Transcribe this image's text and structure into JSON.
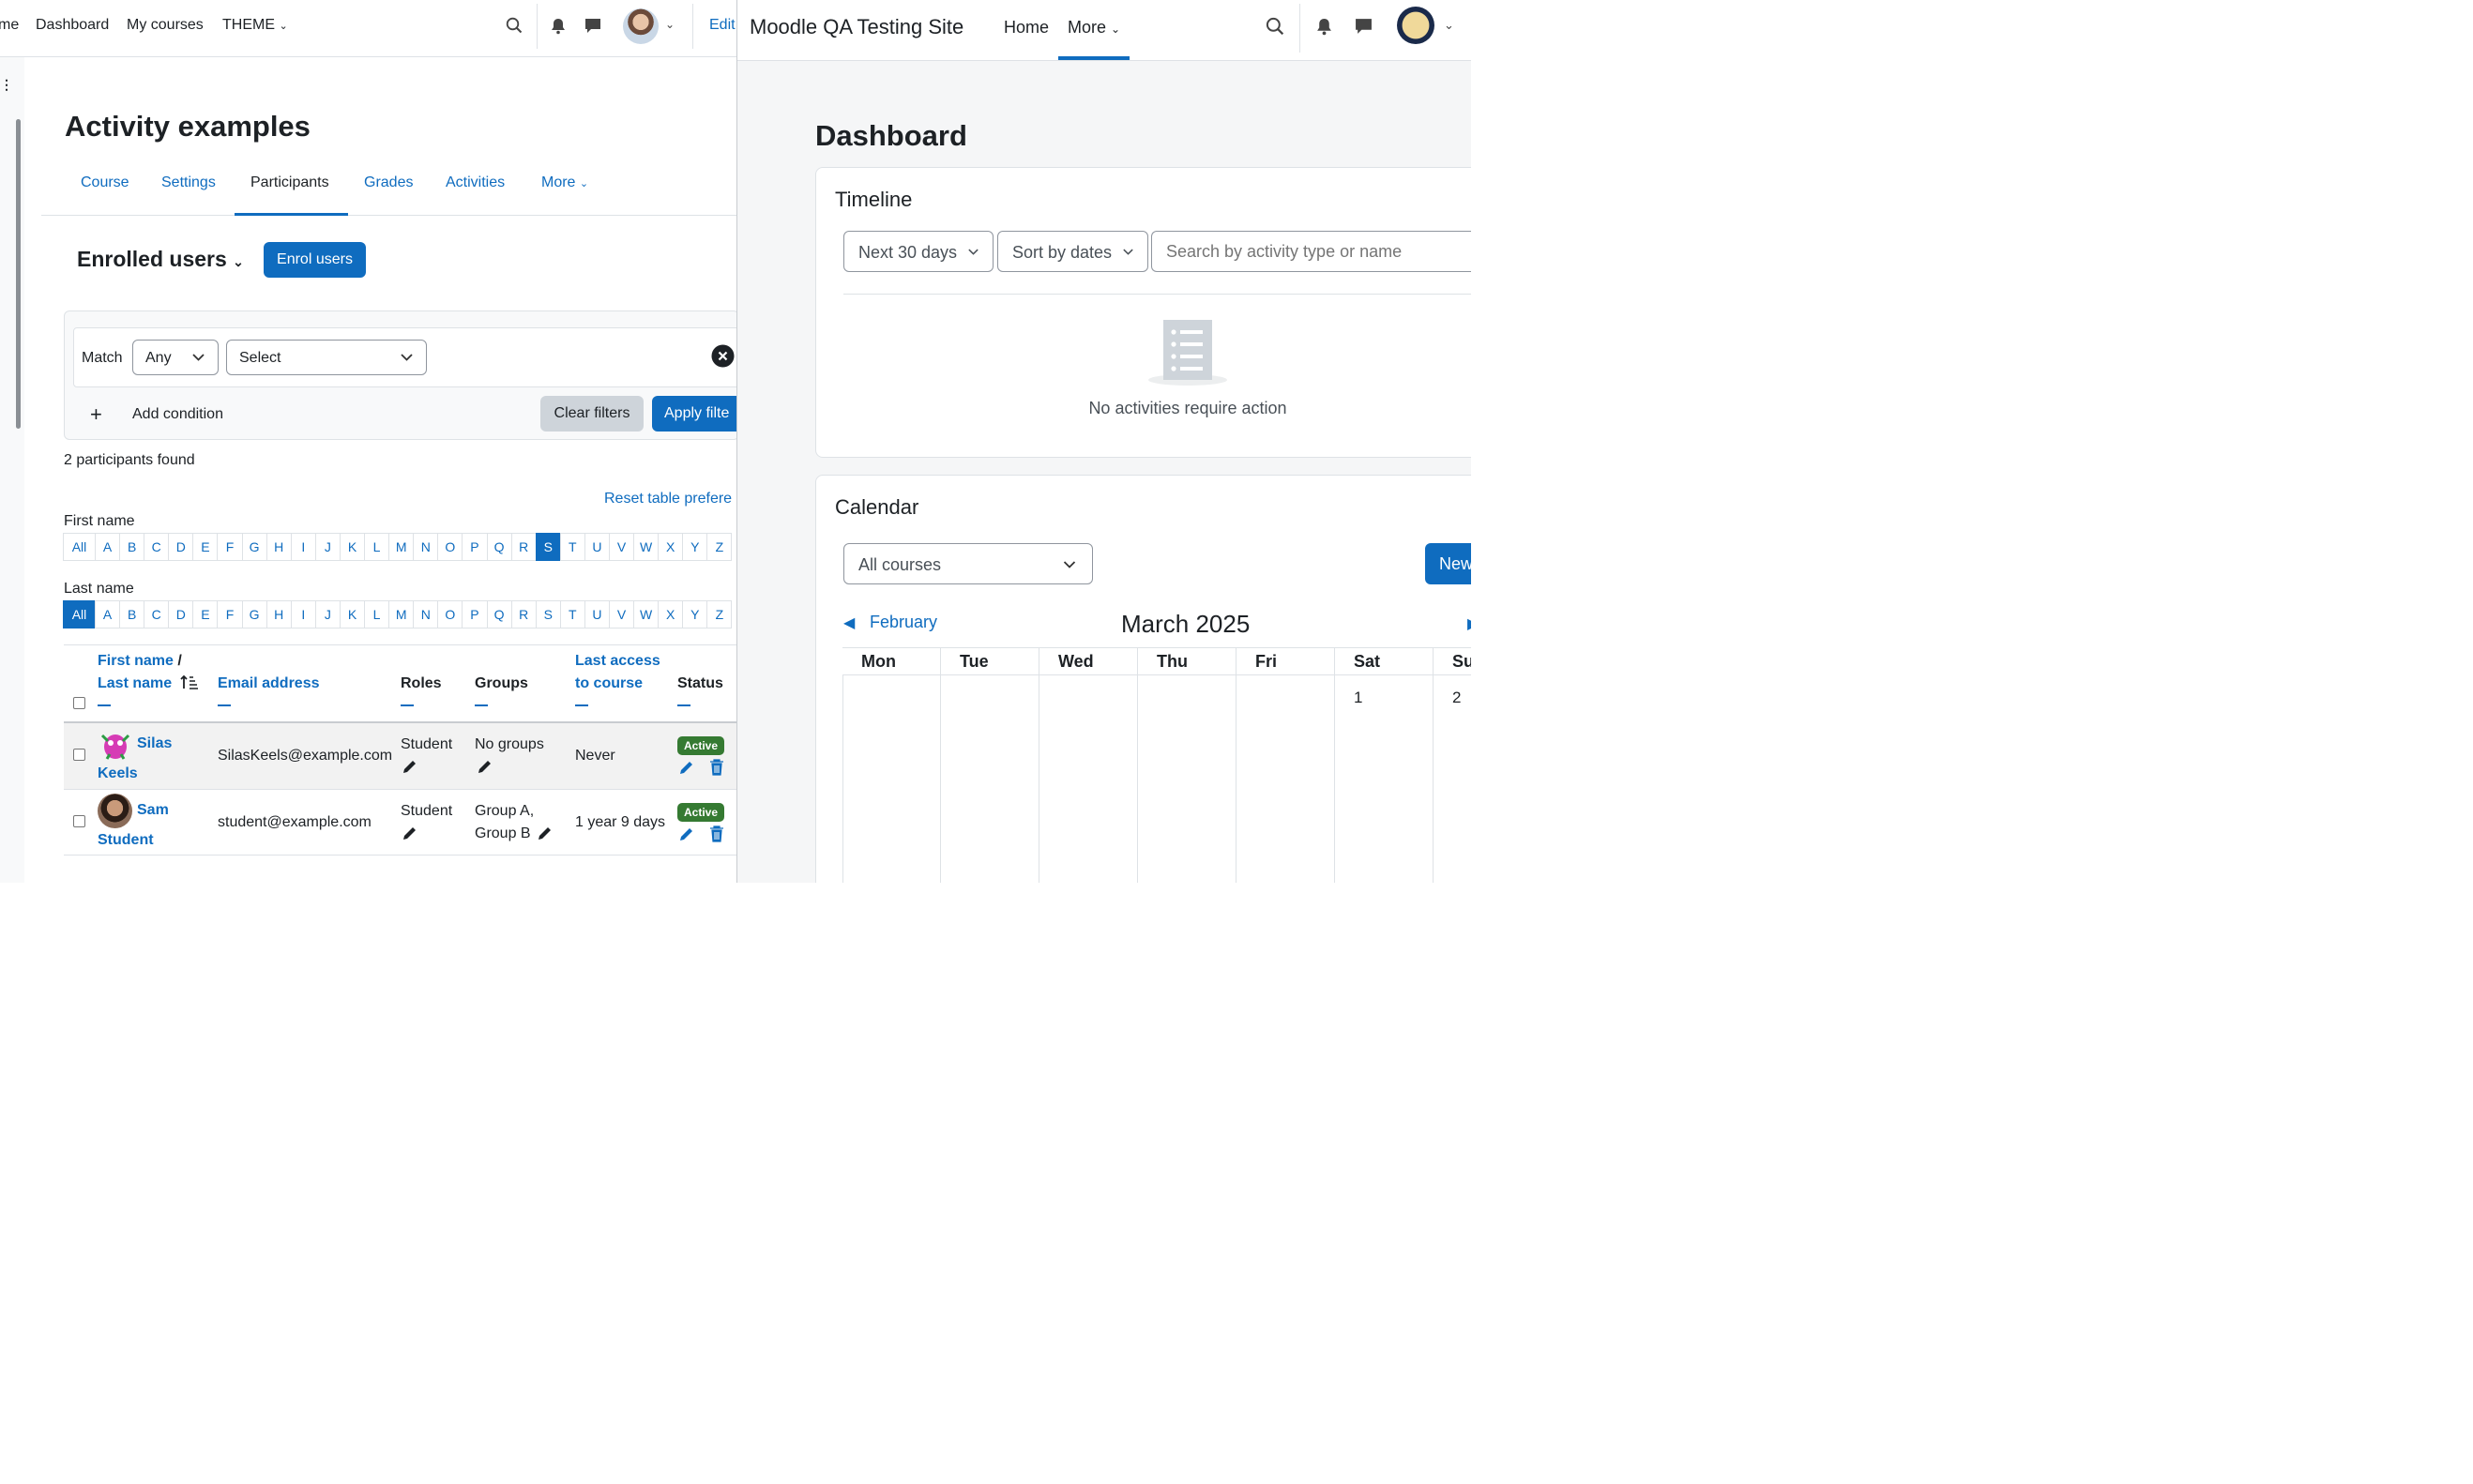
{
  "left": {
    "nav": {
      "partial_home": "me",
      "dashboard": "Dashboard",
      "my_courses": "My courses",
      "theme": "THEME",
      "edit_partial": "Edit"
    },
    "page_title": "Activity examples",
    "tabs": [
      "Course",
      "Settings",
      "Participants",
      "Grades",
      "Activities",
      "More"
    ],
    "enrolled_heading": "Enrolled users",
    "enrol_button": "Enrol users",
    "filter": {
      "match_label": "Match",
      "match_value": "Any",
      "select_value": "Select",
      "add_condition": "Add condition",
      "clear_filters": "Clear filters",
      "apply_filters": "Apply filte"
    },
    "participants_found": "2 participants found",
    "reset_table": "Reset table prefere",
    "first_name_label": "First name",
    "last_name_label": "Last name",
    "letters": [
      "All",
      "A",
      "B",
      "C",
      "D",
      "E",
      "F",
      "G",
      "H",
      "I",
      "J",
      "K",
      "L",
      "M",
      "N",
      "O",
      "P",
      "Q",
      "R",
      "S",
      "T",
      "U",
      "V",
      "W",
      "X",
      "Y",
      "Z"
    ],
    "first_name_selected": "S",
    "last_name_selected": "All",
    "table": {
      "headers": {
        "first_name": "First name",
        "slash": "/",
        "last_name": "Last name",
        "email": "Email address",
        "roles": "Roles",
        "groups": "Groups",
        "last_access_1": "Last access",
        "last_access_2": "to course",
        "status": "Status"
      },
      "rows": [
        {
          "first": "Silas",
          "last": "Keels",
          "email": "SilasKeels@example.com",
          "role": "Student",
          "groups_1": "No groups",
          "groups_2": "",
          "last_access": "Never",
          "status": "Active"
        },
        {
          "first": "Sam",
          "last": "Student",
          "email": "student@example.com",
          "role": "Student",
          "groups_1": "Group A,",
          "groups_2": "Group B",
          "last_access": "1 year 9 days",
          "status": "Active"
        }
      ]
    }
  },
  "right": {
    "site_name": "Moodle QA Testing Site",
    "nav": {
      "home": "Home",
      "more": "More"
    },
    "page_title": "Dashboard",
    "timeline": {
      "title": "Timeline",
      "range": "Next 30 days",
      "sort": "Sort by dates",
      "search_placeholder": "Search by activity type or name",
      "empty_message": "No activities require action"
    },
    "calendar": {
      "title": "Calendar",
      "course_filter": "All courses",
      "new_event_partial": "New",
      "prev_month": "February",
      "month_title": "March 2025",
      "weekdays": [
        "Mon",
        "Tue",
        "Wed",
        "Thu",
        "Fri",
        "Sat",
        "Su"
      ],
      "first_row_days": [
        "",
        "",
        "",
        "",
        "",
        "1",
        "2"
      ]
    }
  },
  "colors": {
    "link": "#0f6cbf",
    "active_badge": "#357a32",
    "secondary_button": "#ced4da"
  }
}
